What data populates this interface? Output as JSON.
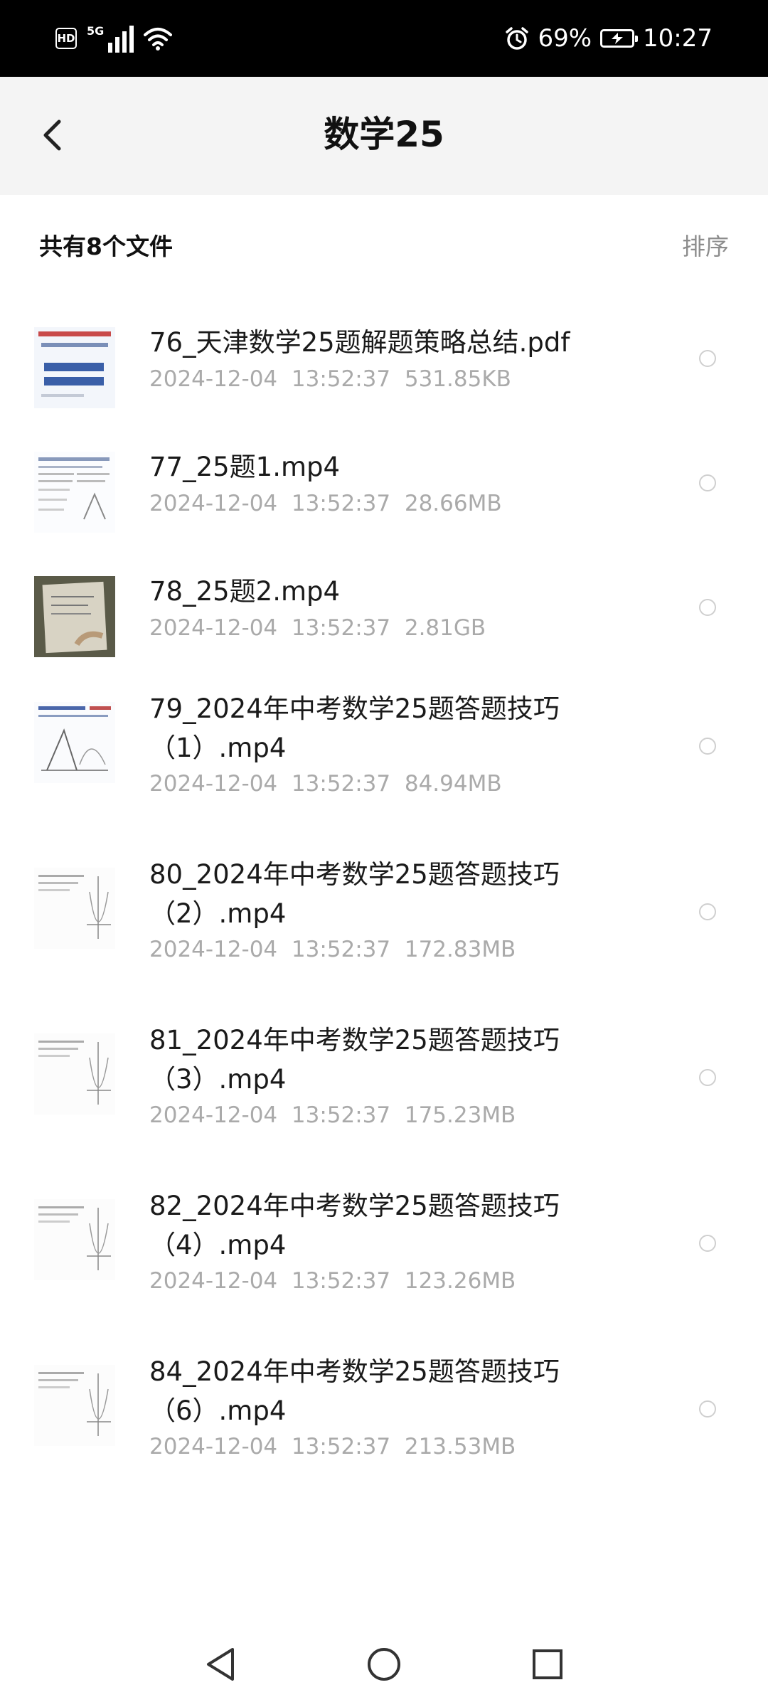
{
  "status_bar": {
    "hd_label": "HD",
    "network_label": "5G",
    "battery_percent": "69%",
    "time": "10:27",
    "icons": [
      "hd-icon",
      "signal-icon",
      "wifi-icon",
      "alarm-icon",
      "battery-charging-icon"
    ]
  },
  "header": {
    "title": "数学25",
    "back_icon": "chevron-left-icon"
  },
  "list_header": {
    "count_text": "共有8个文件",
    "sort_label": "排序"
  },
  "files": [
    {
      "name": "76_天津数学25题解题策略总结.pdf",
      "date": "2024-12-04",
      "time": "13:52:37",
      "size": "531.85KB",
      "thumb_kind": "pdf"
    },
    {
      "name": "77_25题1.mp4",
      "date": "2024-12-04",
      "time": "13:52:37",
      "size": "28.66MB",
      "thumb_kind": "doc"
    },
    {
      "name": "78_25题2.mp4",
      "date": "2024-12-04",
      "time": "13:52:37",
      "size": "2.81GB",
      "thumb_kind": "photo"
    },
    {
      "name": "79_2024年中考数学25题答题技巧（1）.mp4",
      "date": "2024-12-04",
      "time": "13:52:37",
      "size": "84.94MB",
      "thumb_kind": "graph"
    },
    {
      "name": "80_2024年中考数学25题答题技巧（2）.mp4",
      "date": "2024-12-04",
      "time": "13:52:37",
      "size": "172.83MB",
      "thumb_kind": "sketch"
    },
    {
      "name": "81_2024年中考数学25题答题技巧（3）.mp4",
      "date": "2024-12-04",
      "time": "13:52:37",
      "size": "175.23MB",
      "thumb_kind": "sketch"
    },
    {
      "name": "82_2024年中考数学25题答题技巧（4）.mp4",
      "date": "2024-12-04",
      "time": "13:52:37",
      "size": "123.26MB",
      "thumb_kind": "sketch"
    },
    {
      "name": "84_2024年中考数学25题答题技巧（6）.mp4",
      "date": "2024-12-04",
      "time": "13:52:37",
      "size": "213.53MB",
      "thumb_kind": "sketch"
    }
  ],
  "nav_bar": {
    "icons": [
      "back-triangle-icon",
      "home-circle-icon",
      "recents-square-icon"
    ]
  },
  "colors": {
    "status_bg": "#000000",
    "header_bg": "#f4f4f4",
    "text_primary": "#1a1a1a",
    "text_meta": "#aaaaaa",
    "sort_text": "#8d8d8d"
  }
}
